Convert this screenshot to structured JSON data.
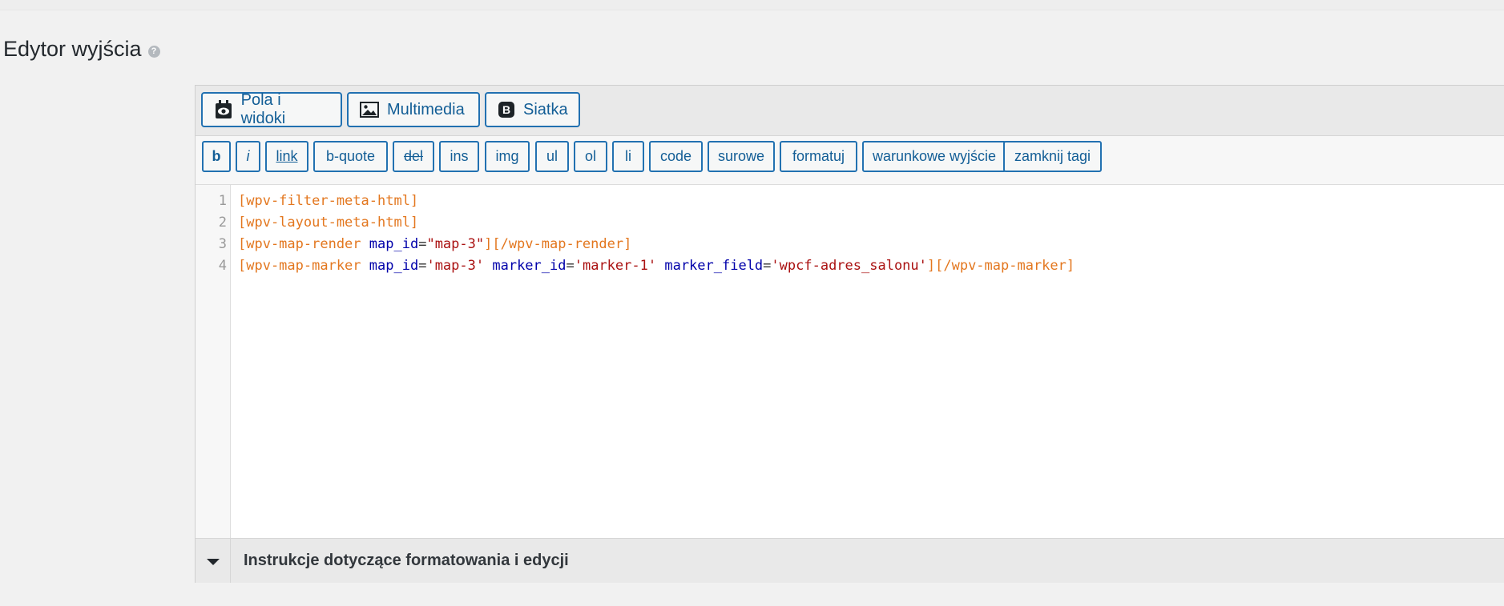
{
  "section": {
    "title": "Edytor wyjścia",
    "help_icon": "question-icon"
  },
  "editor": {
    "main_buttons": [
      {
        "label": "Pola i widoki",
        "icon": "fields-and-views-icon"
      },
      {
        "label": "Multimedia",
        "icon": "image-icon"
      },
      {
        "label": "Siatka",
        "icon": "bootstrap-b-icon"
      }
    ],
    "quicktags": [
      "b",
      "i",
      "link",
      "b-quote",
      "del",
      "ins",
      "img",
      "ul",
      "ol",
      "li",
      "code",
      "surowe",
      "formatuj",
      "warunkowe wyjście",
      "zamknij tagi"
    ],
    "line_numbers": [
      "1",
      "2",
      "3",
      "4"
    ],
    "code_lines": [
      [
        {
          "t": "[wpv-filter-meta-html]",
          "c": "sc"
        }
      ],
      [
        {
          "t": "[wpv-layout-meta-html]",
          "c": "sc"
        }
      ],
      [
        {
          "t": "[wpv-map-render",
          "c": "sc"
        },
        {
          "t": " ",
          "c": "plain"
        },
        {
          "t": "map_id",
          "c": "attr"
        },
        {
          "t": "=",
          "c": "plain"
        },
        {
          "t": "\"map-3\"",
          "c": "str"
        },
        {
          "t": "][/wpv-map-render]",
          "c": "sc"
        }
      ],
      [
        {
          "t": "[wpv-map-marker",
          "c": "sc"
        },
        {
          "t": " ",
          "c": "plain"
        },
        {
          "t": "map_id",
          "c": "attr"
        },
        {
          "t": "=",
          "c": "plain"
        },
        {
          "t": "'map-3'",
          "c": "str"
        },
        {
          "t": " ",
          "c": "plain"
        },
        {
          "t": "marker_id",
          "c": "attr"
        },
        {
          "t": "=",
          "c": "plain"
        },
        {
          "t": "'marker-1'",
          "c": "str"
        },
        {
          "t": " ",
          "c": "plain"
        },
        {
          "t": "marker_field",
          "c": "attr"
        },
        {
          "t": "=",
          "c": "plain"
        },
        {
          "t": "'wpcf-adres_salonu'",
          "c": "str"
        },
        {
          "t": "][/wpv-map-marker]",
          "c": "sc"
        }
      ]
    ],
    "footer": {
      "label": "Instrukcje dotyczące formatowania i edycji",
      "toggle_icon": "triangle-down-icon"
    },
    "colors": {
      "accent": "#2271b1",
      "shortcode": "#e3771f",
      "attribute": "#0000aa",
      "string": "#aa1111"
    }
  }
}
